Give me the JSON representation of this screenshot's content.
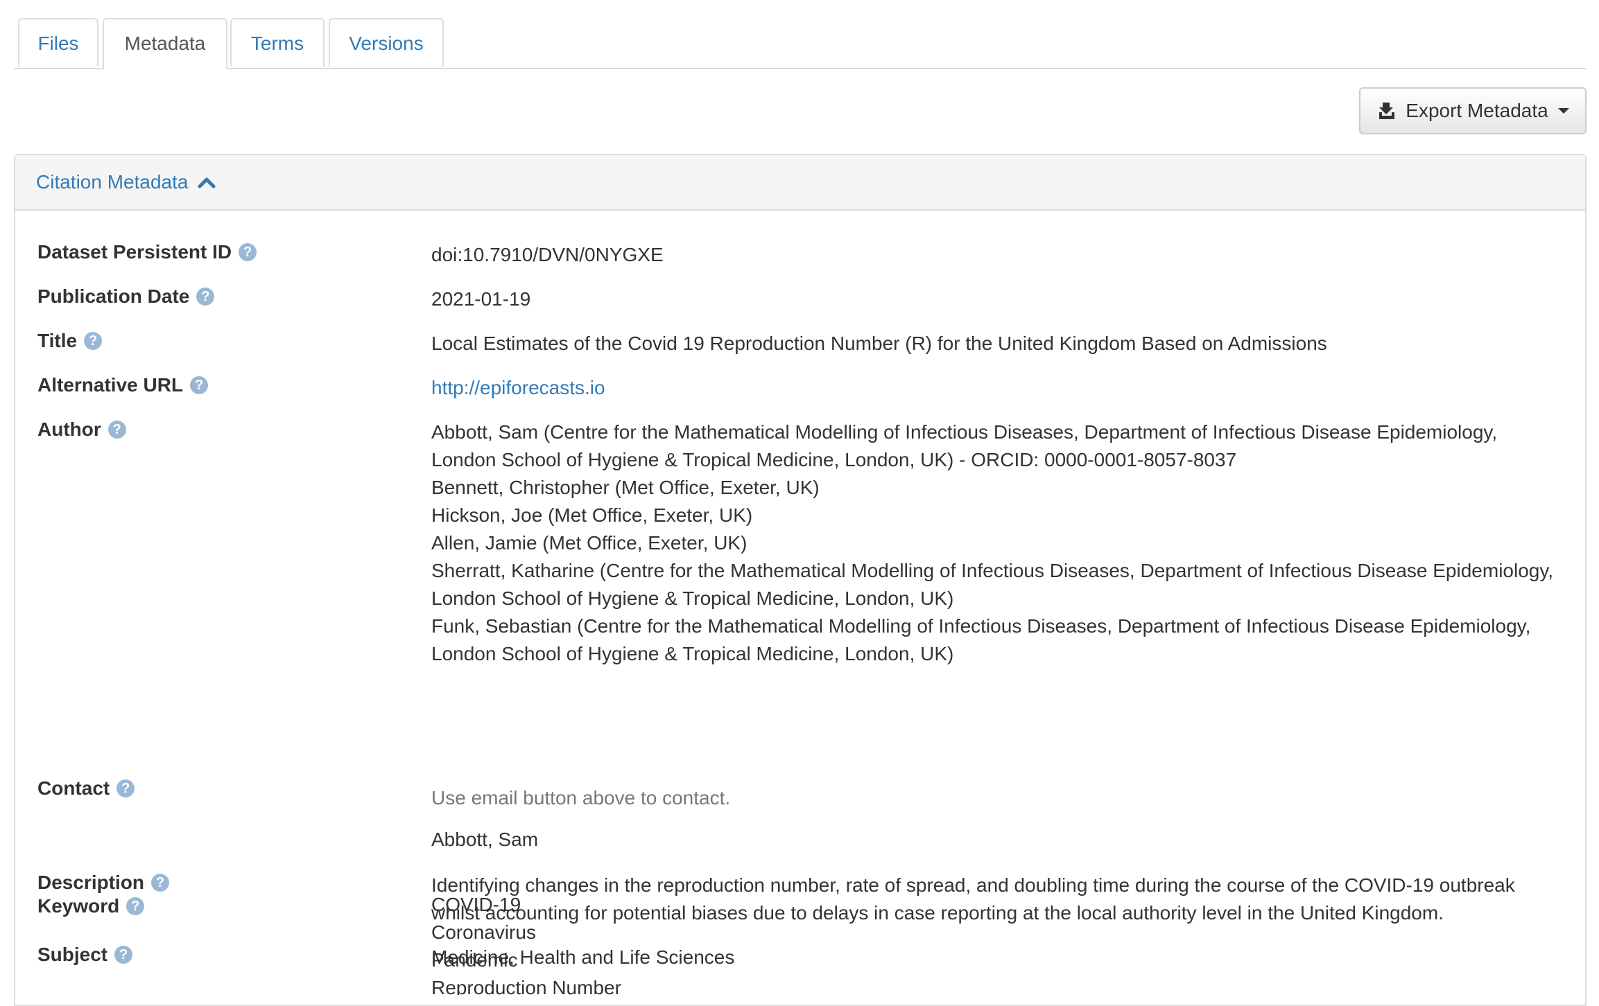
{
  "tabs": [
    {
      "label": "Files",
      "active": false
    },
    {
      "label": "Metadata",
      "active": true
    },
    {
      "label": "Terms",
      "active": false
    },
    {
      "label": "Versions",
      "active": false
    }
  ],
  "export": {
    "label": "Export Metadata",
    "icon": "export-icon"
  },
  "panel": {
    "title": "Citation Metadata",
    "icon": "chevron-up-icon"
  },
  "fields": {
    "persistent_id": {
      "label": "Dataset Persistent ID",
      "value": "doi:10.7910/DVN/0NYGXE"
    },
    "publication_date": {
      "label": "Publication Date",
      "value": "2021-01-19"
    },
    "title": {
      "label": "Title",
      "value": "Local Estimates of the Covid 19 Reproduction Number (R) for the United Kingdom Based on Admissions"
    },
    "alt_url": {
      "label": "Alternative URL",
      "value": "http://epiforecasts.io"
    },
    "author": {
      "label": "Author",
      "lines": [
        "Abbott, Sam (Centre for the Mathematical Modelling of Infectious Diseases, Department of Infectious Disease Epidemiology,",
        "London School of Hygiene & Tropical Medicine, London, UK) - ORCID: 0000-0001-8057-8037",
        "Bennett, Christopher (Met Office, Exeter, UK)",
        "Hickson, Joe (Met Office, Exeter, UK)",
        "Allen, Jamie (Met Office, Exeter, UK)",
        "Sherratt, Katharine (Centre for the Mathematical Modelling of Infectious Diseases, Department of Infectious Disease Epidemiology,",
        "London School of Hygiene & Tropical Medicine, London, UK)",
        "Funk, Sebastian (Centre for the Mathematical Modelling of Infectious Diseases, Department of Infectious Disease Epidemiology,",
        "London School of Hygiene & Tropical Medicine, London, UK)"
      ]
    },
    "contact": {
      "label": "Contact",
      "note": "Use email button above to contact.",
      "name": "Abbott, Sam"
    },
    "description": {
      "label": "Description",
      "lines": [
        "Identifying changes in the reproduction number, rate of spread, and doubling time during the course of the COVID-19 outbreak",
        "whilst accounting for potential biases due to delays in case reporting at the local authority level in the United Kingdom."
      ]
    },
    "subject": {
      "label": "Subject",
      "value": "Medicine, Health and Life Sciences"
    },
    "keyword": {
      "label": "Keyword",
      "lines": [
        "COVID-19",
        "Coronavirus",
        "Pandemic",
        "Reproduction Number"
      ]
    }
  },
  "help_icon": {
    "glyph": "?",
    "icon": "question-circle-icon"
  },
  "colors": {
    "link": "#337ab7",
    "help": "#9ab8d6",
    "muted": "#777777"
  }
}
